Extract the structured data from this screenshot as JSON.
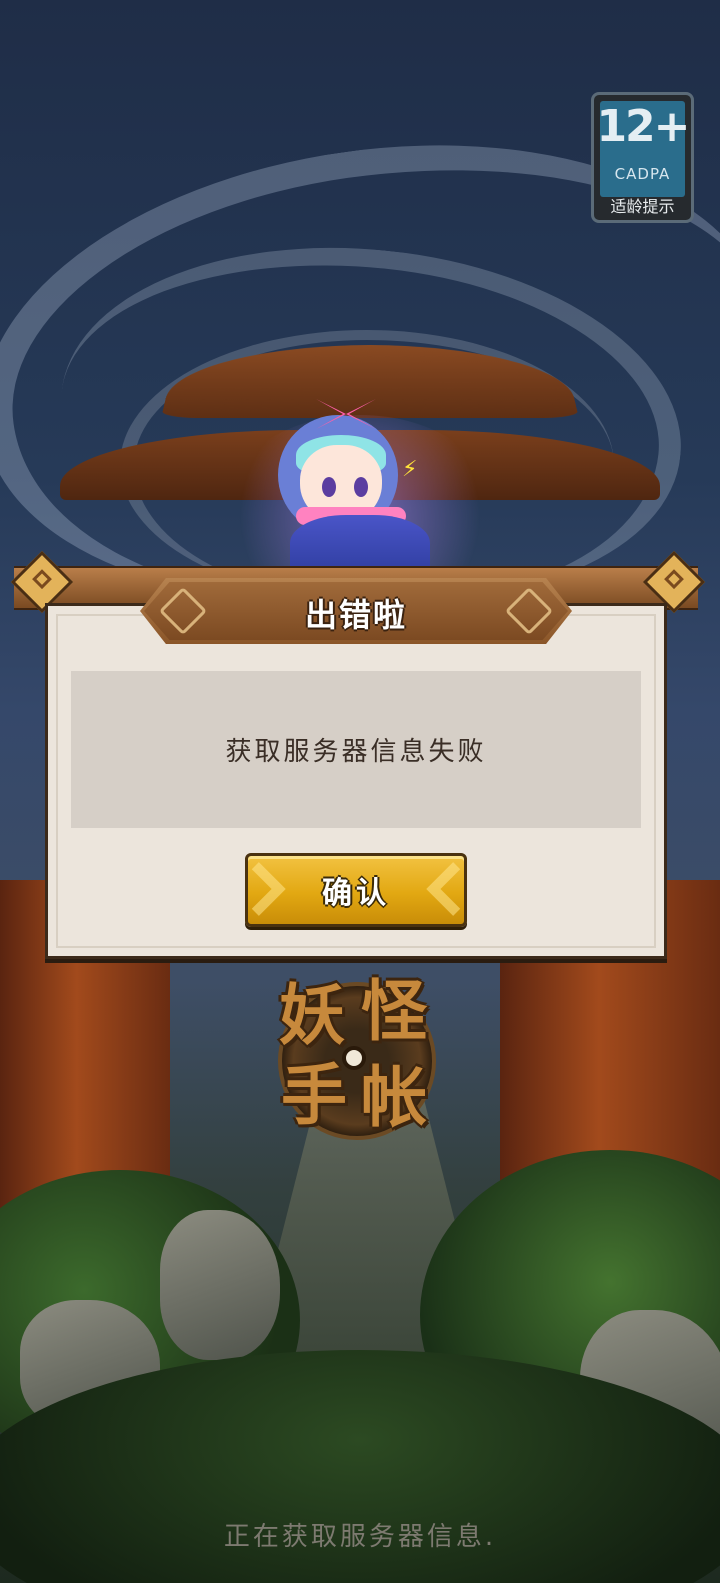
{
  "age_rating": {
    "age": "12+",
    "org": "CADPA",
    "caption": "适龄提示"
  },
  "dialog": {
    "title": "出错啦",
    "message": "获取服务器信息失败",
    "confirm_label": "确认"
  },
  "logo": {
    "chars": [
      "妖",
      "怪",
      "手",
      "帐"
    ]
  },
  "status": {
    "loading_text": "正在获取服务器信息."
  },
  "colors": {
    "dialog_bg": "#ece5dc",
    "message_bg": "#d6cfc7",
    "confirm_button": "#e2a812",
    "title_plate": "#8a5528"
  }
}
